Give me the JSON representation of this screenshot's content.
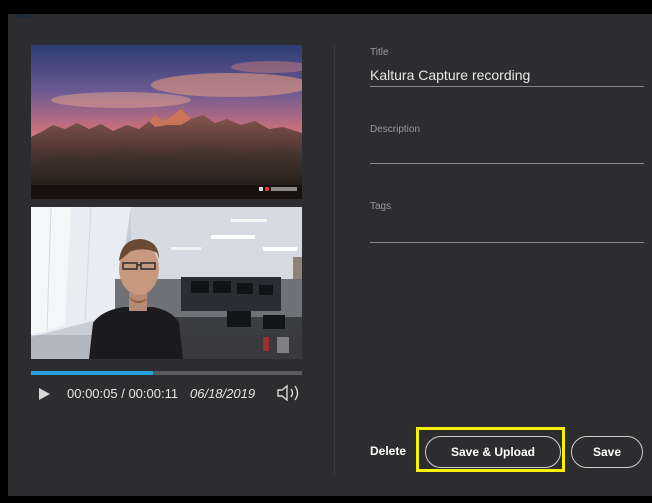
{
  "player": {
    "current_time": "00:00:05",
    "total_time": "00:00:11",
    "time_display": "00:00:05 / 00:00:11",
    "date": "06/18/2019",
    "progress": 0.45,
    "progress_color": "#27a2dc",
    "play_icon": "play-icon",
    "volume_icon": "volume-icon"
  },
  "form": {
    "title_label": "Title",
    "title_value": "Kaltura Capture recording",
    "description_label": "Description",
    "description_value": "",
    "tags_label": "Tags",
    "tags_value": ""
  },
  "actions": {
    "delete_label": "Delete",
    "save_upload_label": "Save & Upload",
    "save_label": "Save"
  },
  "colors": {
    "panel_bg": "#2d2d2f",
    "highlight": "#f6f200",
    "accent": "#27a2dc"
  }
}
